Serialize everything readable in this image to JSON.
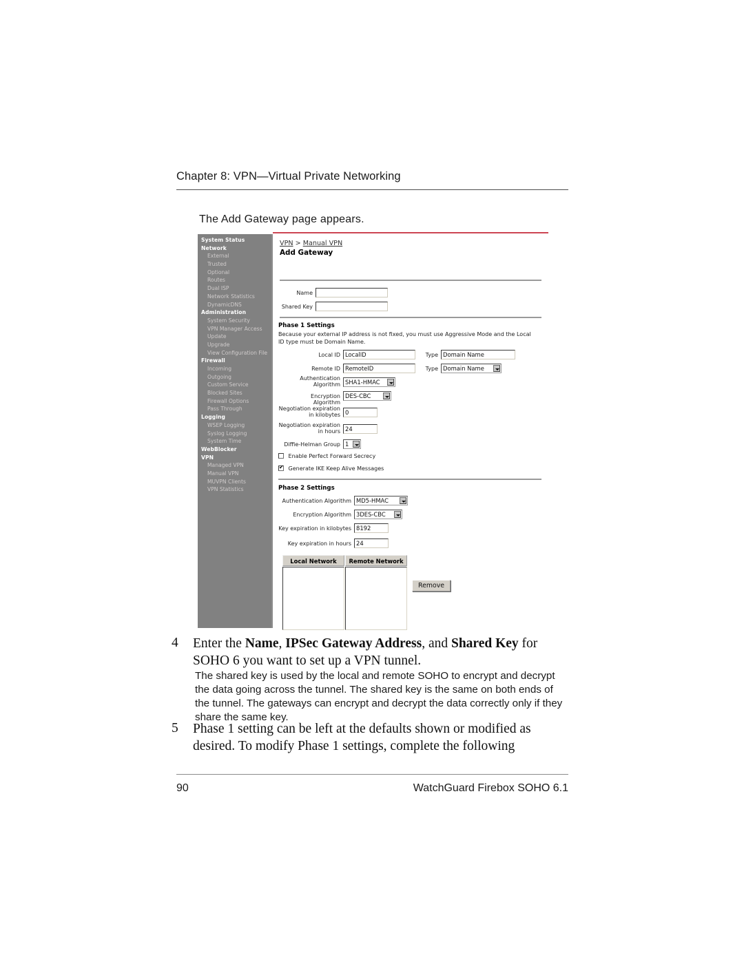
{
  "page": {
    "chapter_header": "Chapter 8: VPN—Virtual Private Networking",
    "intro_line": "The Add Gateway page appears.",
    "footer_page_number": "90",
    "footer_product": "WatchGuard Firebox SOHO 6.1",
    "accent_color": "#cc4452",
    "sidebar_color": "#818181"
  },
  "screenshot": {
    "sidebar": {
      "items": [
        {
          "label": "System Status",
          "type": "group"
        },
        {
          "label": "Network",
          "type": "group"
        },
        {
          "label": "External",
          "type": "child"
        },
        {
          "label": "Trusted",
          "type": "child"
        },
        {
          "label": "Optional",
          "type": "child"
        },
        {
          "label": "Routes",
          "type": "child"
        },
        {
          "label": "Dual ISP",
          "type": "child"
        },
        {
          "label": "Network Statistics",
          "type": "child"
        },
        {
          "label": "DynamicDNS",
          "type": "child"
        },
        {
          "label": "Administration",
          "type": "group"
        },
        {
          "label": "System Security",
          "type": "child"
        },
        {
          "label": "VPN Manager Access",
          "type": "child"
        },
        {
          "label": "Update",
          "type": "child"
        },
        {
          "label": "Upgrade",
          "type": "child"
        },
        {
          "label": "View Configuration File",
          "type": "child"
        },
        {
          "label": "Firewall",
          "type": "group"
        },
        {
          "label": "Incoming",
          "type": "child"
        },
        {
          "label": "Outgoing",
          "type": "child"
        },
        {
          "label": "Custom Service",
          "type": "child"
        },
        {
          "label": "Blocked Sites",
          "type": "child"
        },
        {
          "label": "Firewall Options",
          "type": "child"
        },
        {
          "label": "Pass Through",
          "type": "child"
        },
        {
          "label": "Logging",
          "type": "group"
        },
        {
          "label": "WSEP Logging",
          "type": "child"
        },
        {
          "label": "Syslog Logging",
          "type": "child"
        },
        {
          "label": "System Time",
          "type": "child"
        },
        {
          "label": "WebBlocker",
          "type": "group"
        },
        {
          "label": "VPN",
          "type": "group"
        },
        {
          "label": "Managed VPN",
          "type": "child"
        },
        {
          "label": "Manual VPN",
          "type": "child"
        },
        {
          "label": "MUVPN Clients",
          "type": "child"
        },
        {
          "label": "VPN Statistics",
          "type": "child"
        }
      ]
    },
    "breadcrumb": {
      "root": "VPN",
      "separator": ">",
      "current": "Manual VPN"
    },
    "title": "Add Gateway",
    "top_fields": [
      {
        "label": "Name",
        "value": ""
      },
      {
        "label": "Shared Key",
        "value": ""
      }
    ],
    "phase1": {
      "heading": "Phase 1 Settings",
      "note": "Because your external IP address is not fixed, you must use Aggressive Mode and the Local ID type must be Domain Name.",
      "local_id_label": "Local ID",
      "local_id_value": "LocalID",
      "local_type_label": "Type",
      "local_type_value": "Domain Name",
      "remote_id_label": "Remote ID",
      "remote_id_value": "RemoteID",
      "remote_type_label": "Type",
      "remote_type_value": "Domain Name",
      "auth_algorithm_label_1": "Authentication",
      "auth_algorithm_label_2": "Algorithm",
      "auth_algorithm_value": "SHA1-HMAC",
      "encryption_algorithm_label": "Encryption Algorithm",
      "encryption_algorithm_value": "DES-CBC",
      "neg_kb_label_1": "Negotiation expiration",
      "neg_kb_label_2": "in kilobytes",
      "neg_kb_value": "0",
      "neg_hr_label_1": "Negotiation expiration",
      "neg_hr_label_2": "in hours",
      "neg_hr_value": "24",
      "dh_group_label": "Diffie-Helman Group",
      "dh_group_value": "1",
      "pfs_label": "Enable Perfect Forward Secrecy",
      "pfs_checked": false,
      "ike_label": "Generate IKE Keep Alive Messages",
      "ike_checked": true
    },
    "phase2": {
      "heading": "Phase 2 Settings",
      "auth_algorithm_label": "Authentication Algorithm",
      "auth_algorithm_value": "MD5-HMAC",
      "encryption_algorithm_label": "Encryption Algorithm",
      "encryption_algorithm_value": "3DES-CBC",
      "key_kb_label": "Key expiration in kilobytes",
      "key_kb_value": "8192",
      "key_hr_label": "Key expiration in hours",
      "key_hr_value": "24"
    },
    "networks": {
      "local_header": "Local Network",
      "remote_header": "Remote Network",
      "local_items": [],
      "remote_items": [],
      "remove_button": "Remove"
    }
  },
  "steps": [
    {
      "number": "4",
      "lead_parts": [
        {
          "text": "Enter the ",
          "bold": false
        },
        {
          "text": "Name",
          "bold": true
        },
        {
          "text": ", ",
          "bold": false
        },
        {
          "text": "IPSec Gateway Address",
          "bold": true
        },
        {
          "text": ", and ",
          "bold": false
        },
        {
          "text": "Shared Key",
          "bold": true
        },
        {
          "text": " for SOHO 6 you want to set up a VPN tunnel.",
          "bold": false
        }
      ],
      "body": "The shared key is used by the local and remote SOHO to encrypt and decrypt the data going across the tunnel. The shared key is the same on both ends of the tunnel. The gateways can encrypt and decrypt the data correctly only if they share the same key."
    },
    {
      "number": "5",
      "lead_plain": "Phase 1 setting can be left at the defaults shown or modified as desired. To modify Phase 1 settings, complete the following",
      "body": ""
    }
  ]
}
